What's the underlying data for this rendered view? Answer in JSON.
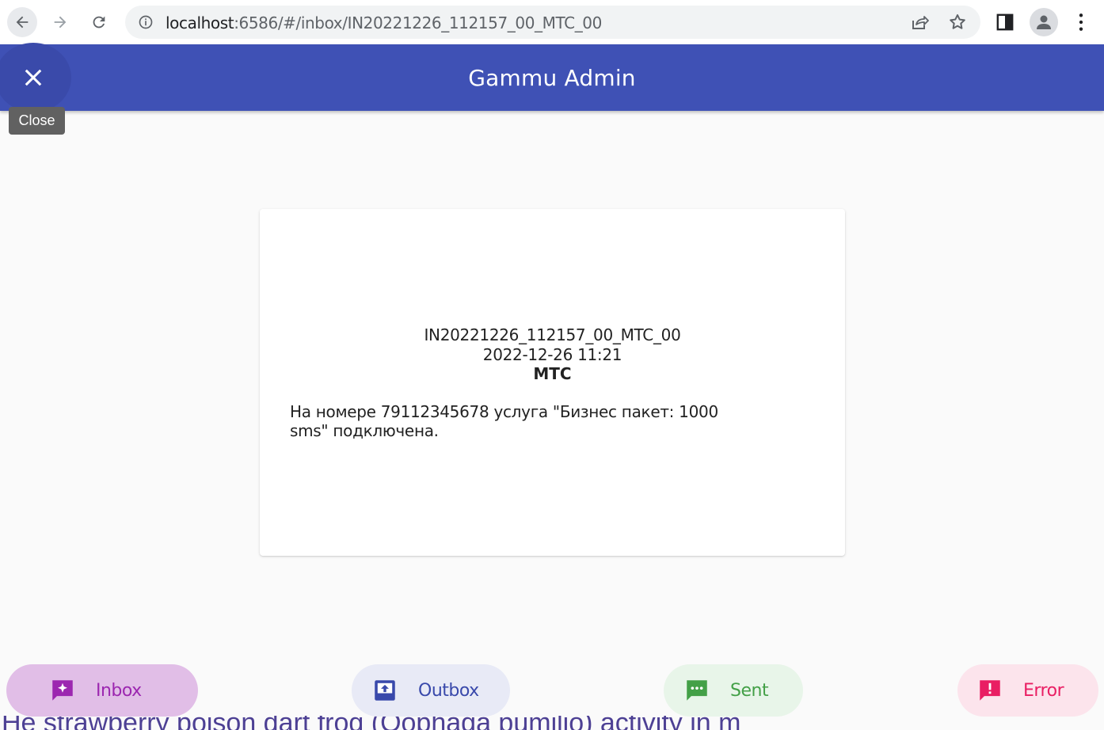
{
  "browser": {
    "url_host": "localhost",
    "url_rest": ":6586/#/inbox/IN20221226_112157_00_MTC_00",
    "icons": [
      "back-arrow-icon",
      "forward-arrow-icon",
      "reload-icon",
      "site-info-icon",
      "share-icon",
      "star-icon",
      "side-panel-icon",
      "profile-icon",
      "kebab-menu-icon"
    ]
  },
  "appbar": {
    "title": "Gammu Admin",
    "close_tooltip": "Close",
    "color": "#3f51b5"
  },
  "message": {
    "id": "IN20221226_112157_00_MTC_00",
    "date": "2022-12-26 11:21",
    "sender": "MTC",
    "text": "На номере 79112345678 услуга \"Бизнес пакет: 1000 sms\" подключена."
  },
  "background_text": "He strawberry poison dart frog (Oophaga pumilio) activity in m",
  "nav": {
    "inbox": {
      "label": "Inbox",
      "color": "#9c27b0",
      "icon": "inbox-new-message-icon"
    },
    "outbox": {
      "label": "Outbox",
      "color": "#3949ab",
      "icon": "outbox-upload-icon"
    },
    "sent": {
      "label": "Sent",
      "color": "#43a047",
      "icon": "sent-message-icon"
    },
    "error": {
      "label": "Error",
      "color": "#e91e63",
      "icon": "error-message-icon"
    }
  }
}
